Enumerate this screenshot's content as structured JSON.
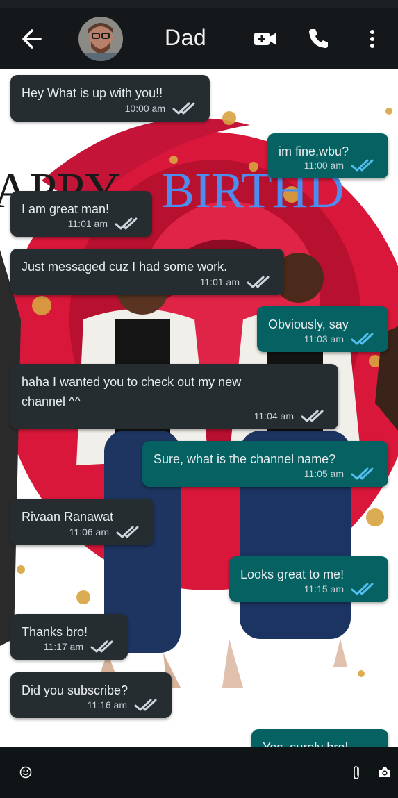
{
  "contact": {
    "name": "Dad"
  },
  "header_icons": [
    "back-arrow-icon",
    "video-call-icon",
    "phone-icon",
    "more-vert-icon"
  ],
  "wallpaper": {
    "banner_text_1": "APPY",
    "banner_text_2": "BIRTHD"
  },
  "messages": [
    {
      "from": "in",
      "text": "Hey What is up with you!!",
      "time": "10:00 am",
      "status": "read"
    },
    {
      "from": "out",
      "text": "im fine,wbu?",
      "time": "11:00 am",
      "status": "read"
    },
    {
      "from": "in",
      "text": "I am great man!",
      "time": "11:01 am",
      "status": "read"
    },
    {
      "from": "in",
      "text": "Just messaged cuz I had some work.",
      "time": "11:01 am",
      "status": "read"
    },
    {
      "from": "out",
      "text": "Obviously, say",
      "time": "11:03 am",
      "status": "read"
    },
    {
      "from": "in",
      "text": "haha I wanted you to check out my new\nchannel ^^",
      "time": "11:04 am",
      "status": "read"
    },
    {
      "from": "out",
      "text": "Sure, what is the channel name?",
      "time": "11:05 am",
      "status": "read"
    },
    {
      "from": "in",
      "text": "Rivaan Ranawat",
      "time": "11:06 am",
      "status": "read"
    },
    {
      "from": "out",
      "text": "Looks great to me!",
      "time": "11:15 am",
      "status": "read"
    },
    {
      "from": "in",
      "text": "Thanks bro!",
      "time": "11:17 am",
      "status": "read"
    },
    {
      "from": "in",
      "text": "Did you subscribe?",
      "time": "11:16 am",
      "status": "read"
    },
    {
      "from": "out",
      "text": "Yes, surely bro!",
      "time": "",
      "status": "read"
    }
  ],
  "composer_icons": [
    "emoji-icon",
    "attach-icon",
    "camera-icon"
  ],
  "colors": {
    "incoming_bubble": "#262d31",
    "outgoing_bubble": "#056162",
    "read_tick": "#53bdeb",
    "header_bg": "#15181b"
  }
}
